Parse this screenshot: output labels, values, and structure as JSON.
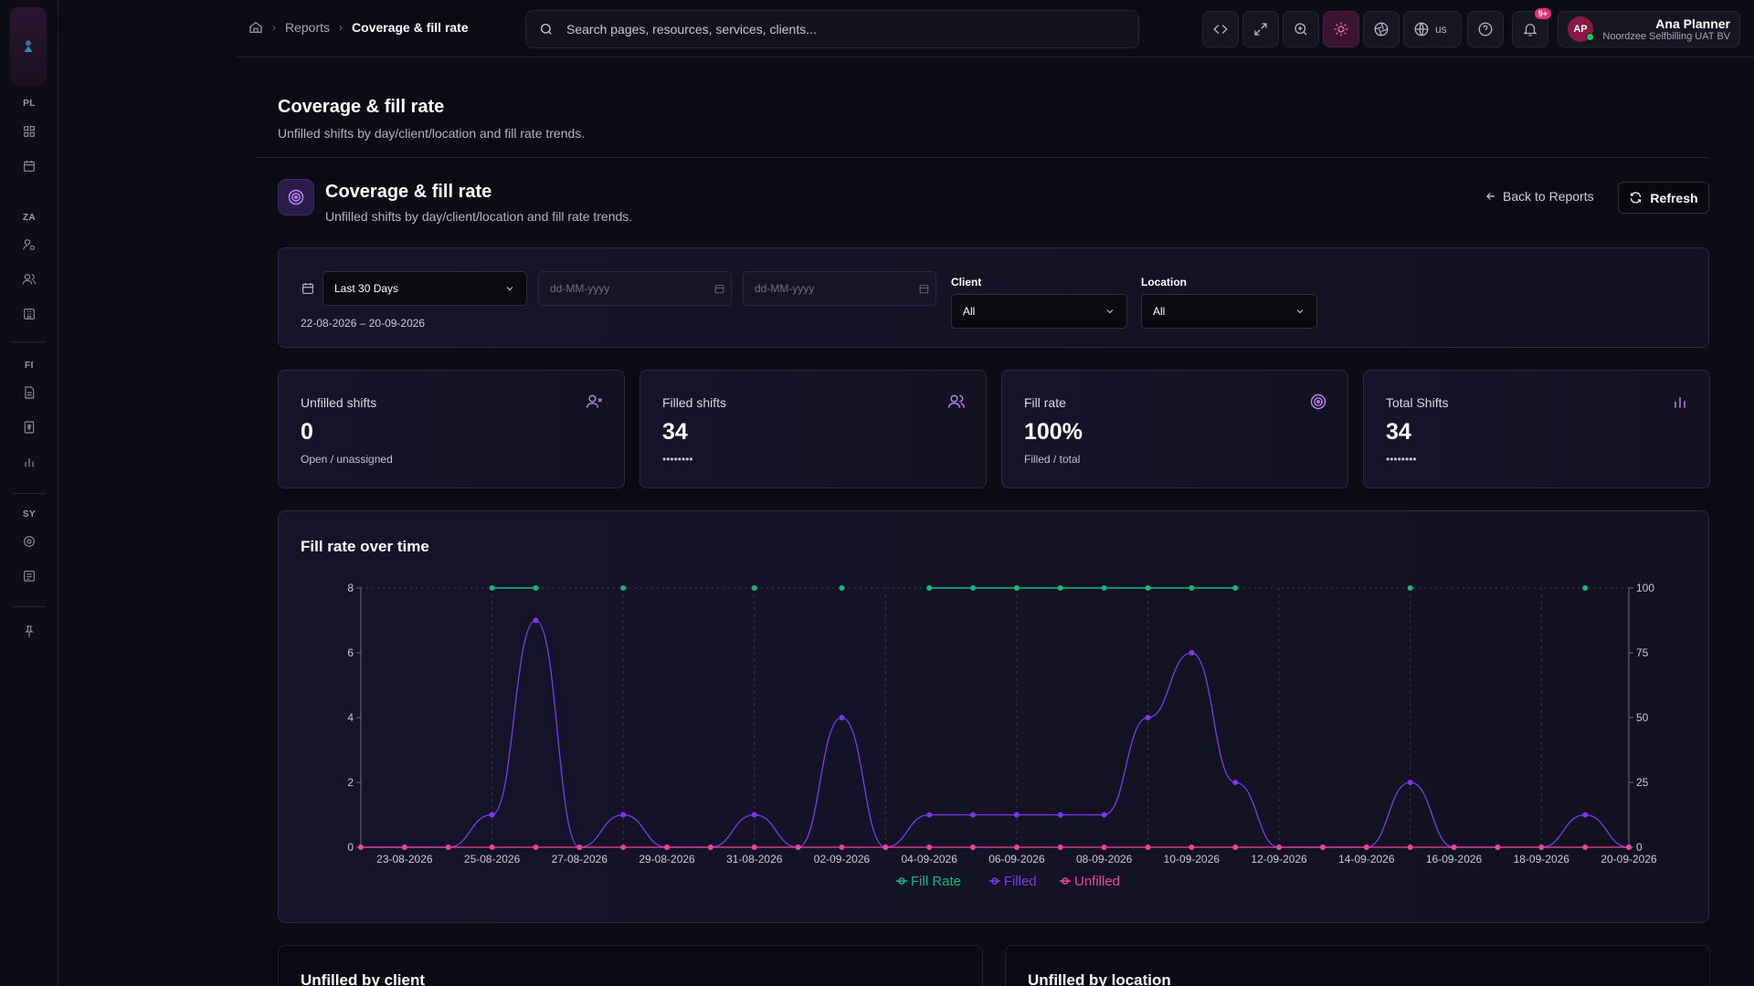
{
  "sidebar": {
    "sections": [
      {
        "label": "PL",
        "icons": [
          "dashboard-icon",
          "calendar-icon"
        ]
      },
      {
        "label": "ZA",
        "icons": [
          "user-cog-icon",
          "users-icon",
          "building-icon"
        ]
      },
      {
        "label": "FI",
        "icons": [
          "document-icon",
          "invoice-icon",
          "bar-chart-icon"
        ]
      },
      {
        "label": "SY",
        "icons": [
          "settings-icon",
          "report-icon"
        ]
      }
    ],
    "bottom_icon": "pin-icon"
  },
  "breadcrumb": {
    "home_icon": "home-icon",
    "items": [
      "Reports",
      "Coverage & fill rate"
    ]
  },
  "search": {
    "placeholder": "Search pages, resources, services, clients..."
  },
  "toolbar": {
    "language": "us",
    "notifications_badge": "9+"
  },
  "user": {
    "initials": "AP",
    "name": "Ana Planner",
    "org": "Noordzee Selfbilling UAT BV"
  },
  "page": {
    "title": "Coverage & fill rate",
    "subtitle": "Unfilled shifts by day/client/location and fill rate trends."
  },
  "section": {
    "title": "Coverage & fill rate",
    "subtitle": "Unfilled shifts by day/client/location and fill rate trends.",
    "back_label": "Back to Reports",
    "refresh_label": "Refresh"
  },
  "filters": {
    "period": "Last 30 Days",
    "from_placeholder": "dd-MM-yyyy",
    "to_placeholder": "dd-MM-yyyy",
    "range": "22-08-2026 – 20-09-2026",
    "client_label": "Client",
    "client_value": "All",
    "location_label": "Location",
    "location_value": "All"
  },
  "stats": [
    {
      "label": "Unfilled shifts",
      "value": "0",
      "sub": "Open / unassigned",
      "icon": "user-x-icon"
    },
    {
      "label": "Filled shifts",
      "value": "34",
      "sub": "••••••••",
      "icon": "users-icon"
    },
    {
      "label": "Fill rate",
      "value": "100%",
      "sub": "Filled / total",
      "icon": "target-icon"
    },
    {
      "label": "Total Shifts",
      "value": "34",
      "sub": "••••••••",
      "icon": "bar-chart-icon"
    }
  ],
  "chart_title": "Fill rate over time",
  "chart_data": {
    "type": "line",
    "title": "Fill rate over time",
    "x": [
      "22-08-2026",
      "23-08-2026",
      "24-08-2026",
      "25-08-2026",
      "26-08-2026",
      "27-08-2026",
      "28-08-2026",
      "29-08-2026",
      "30-08-2026",
      "31-08-2026",
      "01-09-2026",
      "02-09-2026",
      "03-09-2026",
      "04-09-2026",
      "05-09-2026",
      "06-09-2026",
      "07-09-2026",
      "08-09-2026",
      "09-09-2026",
      "10-09-2026",
      "11-09-2026",
      "12-09-2026",
      "13-09-2026",
      "14-09-2026",
      "15-09-2026",
      "16-09-2026",
      "17-09-2026",
      "18-09-2026",
      "19-09-2026",
      "20-09-2026"
    ],
    "x_tick_labels": [
      "23-08-2026",
      "25-08-2026",
      "27-08-2026",
      "29-08-2026",
      "31-08-2026",
      "02-09-2026",
      "04-09-2026",
      "06-09-2026",
      "08-09-2026",
      "10-09-2026",
      "12-09-2026",
      "14-09-2026",
      "16-09-2026",
      "18-09-2026",
      "20-09-2026"
    ],
    "y_left_range": [
      0,
      8
    ],
    "y_left_ticks": [
      0,
      2,
      4,
      6,
      8
    ],
    "y_right_range": [
      0,
      100
    ],
    "y_right_ticks": [
      0,
      25,
      50,
      75,
      100
    ],
    "series": [
      {
        "name": "Fill Rate",
        "axis": "right",
        "color": "#10b981",
        "values": [
          null,
          null,
          null,
          100,
          100,
          null,
          100,
          null,
          null,
          100,
          null,
          100,
          null,
          100,
          100,
          100,
          100,
          100,
          100,
          100,
          100,
          null,
          null,
          null,
          100,
          null,
          null,
          null,
          100,
          null
        ]
      },
      {
        "name": "Filled",
        "axis": "left",
        "color": "#7c3aed",
        "values": [
          0,
          0,
          0,
          1,
          7,
          0,
          1,
          0,
          0,
          1,
          0,
          4,
          0,
          1,
          1,
          1,
          1,
          1,
          4,
          6,
          2,
          0,
          0,
          0,
          2,
          0,
          0,
          0,
          1,
          0
        ]
      },
      {
        "name": "Unfilled",
        "axis": "left",
        "color": "#ec4899",
        "values": [
          0,
          0,
          0,
          0,
          0,
          0,
          0,
          0,
          0,
          0,
          0,
          0,
          0,
          0,
          0,
          0,
          0,
          0,
          0,
          0,
          0,
          0,
          0,
          0,
          0,
          0,
          0,
          0,
          0,
          0
        ]
      }
    ],
    "legend_position": "bottom",
    "grid": true
  },
  "bottom": {
    "left_title": "Unfilled by client",
    "right_title": "Unfilled by location"
  }
}
